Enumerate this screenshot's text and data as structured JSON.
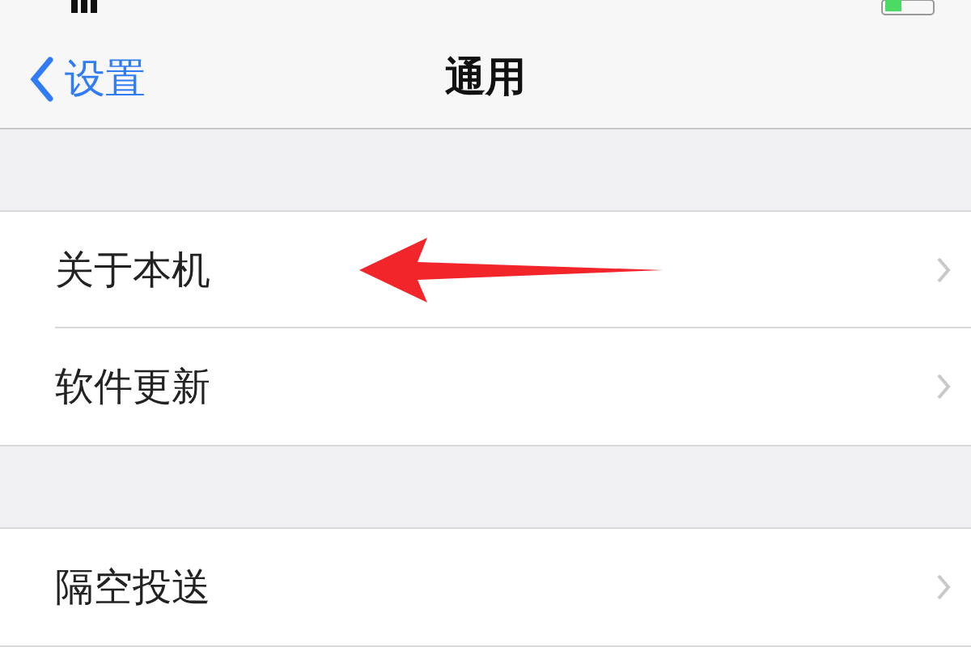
{
  "nav": {
    "back": "设置",
    "title": "通用"
  },
  "groups": [
    {
      "rows": [
        {
          "label": "关于本机",
          "highlighted": true
        },
        {
          "label": "软件更新",
          "highlighted": false
        }
      ]
    },
    {
      "rows": [
        {
          "label": "隔空投送",
          "highlighted": false
        }
      ]
    }
  ]
}
